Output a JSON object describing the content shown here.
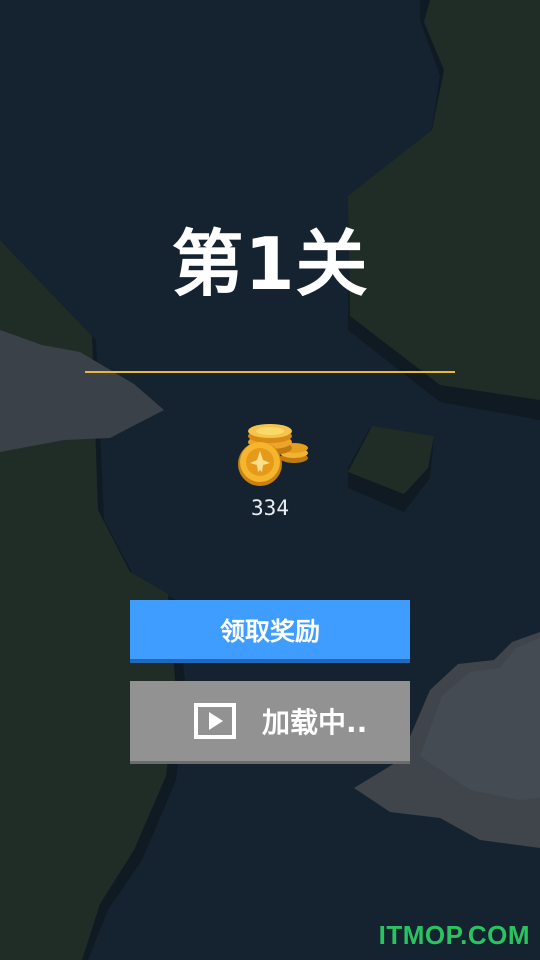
{
  "level": {
    "title": "第1关"
  },
  "reward": {
    "coin_icon": "coin-stack-icon",
    "coins": "334"
  },
  "buttons": {
    "claim_label": "领取奖励",
    "video_label": "加载中..",
    "video_icon": "video-play-icon"
  },
  "watermark": "ITMOP.COM",
  "colors": {
    "sea": "#15222f",
    "land": "#1f2d26",
    "claim_button": "#3f9dff",
    "video_button": "#929292",
    "divider": "#e8b83a",
    "watermark": "#29c45f"
  }
}
